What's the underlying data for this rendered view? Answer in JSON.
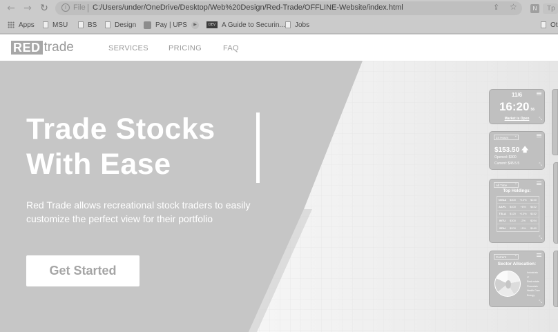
{
  "browser": {
    "file_label": "File",
    "url": "C:/Users/under/OneDrive/Desktop/Web%20Design/Red-Trade/OFFLINE-Website/index.html",
    "profile_label": "Tp",
    "bookmarks": [
      {
        "label": "Apps",
        "icon": "apps-grid-icon"
      },
      {
        "label": "MSU",
        "icon": "page-icon"
      },
      {
        "label": "BS",
        "icon": "page-icon"
      },
      {
        "label": "Design",
        "icon": "page-icon"
      },
      {
        "label": "Pay | UPS",
        "icon": "ups-icon"
      },
      {
        "label": "",
        "icon": "play-icon"
      },
      {
        "label": "A Guide to Securin...",
        "icon": "dev-icon"
      },
      {
        "label": "Jobs",
        "icon": "page-icon"
      },
      {
        "label": "Ot",
        "icon": "page-icon"
      }
    ],
    "dev_badge": "DEV"
  },
  "site_nav": {
    "logo_red": "RED",
    "logo_trade": "trade",
    "links": [
      "SERVICES",
      "PRICING",
      "FAQ"
    ]
  },
  "hero": {
    "headline_line1": "Trade Stocks",
    "headline_line2": "With Ease",
    "subtext": "Red Trade allows recreational stock traders to easily customize the perfect view for their portfolio",
    "cta_label": "Get Started"
  },
  "widgets": {
    "clock": {
      "date": "11/6",
      "time": "16:20",
      "seconds": "56",
      "status": "Market is Open"
    },
    "price": {
      "range": "24 Hours",
      "value": "$153.50",
      "opened": "Opened: $300",
      "current": "Current: $45.5.5"
    },
    "holdings": {
      "range": "All Time",
      "title": "Top Holdings:",
      "rows": [
        [
          "NVDA",
          "$300",
          "+10%",
          "$240"
        ],
        [
          "AAPL",
          "$400",
          "+6%",
          "$452"
        ],
        [
          "TSLA",
          "$120",
          "+13%",
          "$152"
        ],
        [
          "INTU",
          "$300",
          "-2%",
          "$294"
        ],
        [
          "SPAI",
          "$200",
          "+5%",
          "$180"
        ]
      ]
    },
    "allocation": {
      "range": "Current",
      "title": "Sector Allocation:",
      "legend": [
        "Industrials",
        "IT",
        "Real estate",
        "Financials",
        "Health Care",
        "Energy"
      ]
    }
  },
  "colors": {
    "hero_background": "#c6c6c6",
    "nav_background": "#ffffff",
    "cta_text": "#a5a5a5"
  }
}
